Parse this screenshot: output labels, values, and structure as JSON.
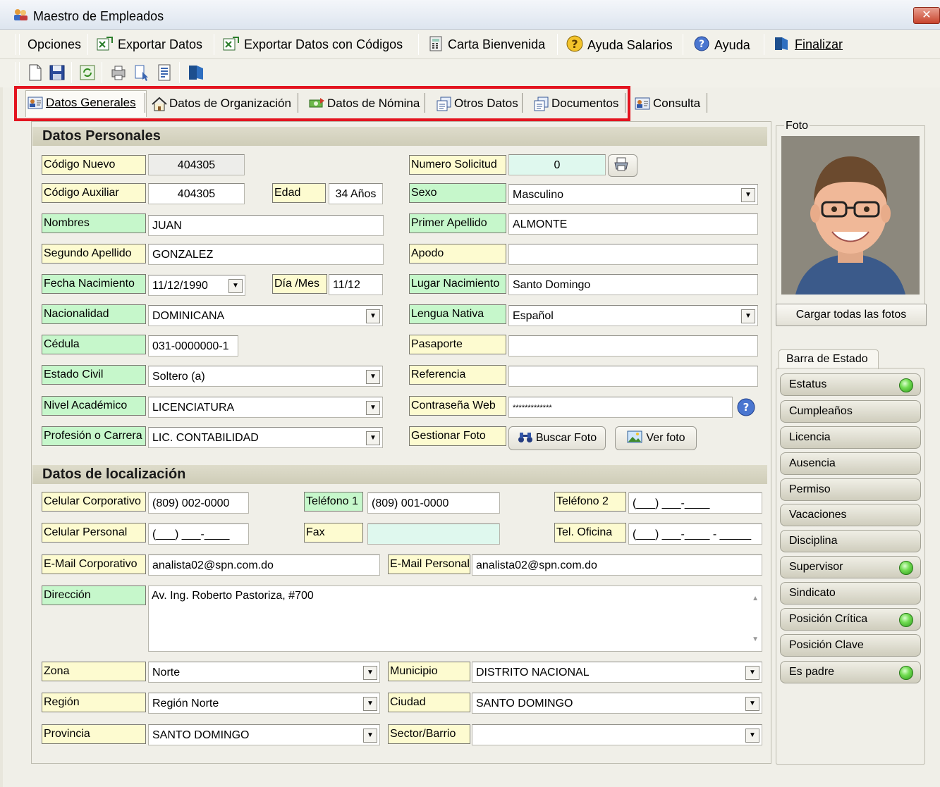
{
  "window": {
    "title": "Maestro de Empleados"
  },
  "menu": [
    {
      "label": "Opciones",
      "icon": "none"
    },
    {
      "label": "Exportar Datos",
      "icon": "excel-icon"
    },
    {
      "label": "Exportar Datos con Códigos",
      "icon": "excel-icon"
    },
    {
      "label": "Carta Bienvenida",
      "icon": "calculator-icon"
    },
    {
      "label": "Ayuda Salarios",
      "icon": "question-icon"
    },
    {
      "label": "Ayuda",
      "icon": "help-icon"
    },
    {
      "label": "Finalizar",
      "icon": "exit-icon"
    }
  ],
  "tabs": [
    {
      "label": "Datos Generales",
      "icon": "person-card-icon",
      "active": true
    },
    {
      "label": "Datos de Organización",
      "icon": "home-icon"
    },
    {
      "label": "Datos de Nómina",
      "icon": "money-icon"
    },
    {
      "label": "Otros Datos",
      "icon": "documents-icon"
    },
    {
      "label": "Documentos",
      "icon": "documents-icon"
    },
    {
      "label": "Consulta",
      "icon": "person-card-icon"
    }
  ],
  "sections": {
    "personal": "Datos Personales",
    "location": "Datos de localización"
  },
  "personal": {
    "codigo_nuevo": {
      "label": "Código Nuevo",
      "value": "404305"
    },
    "codigo_auxiliar": {
      "label": "Código Auxiliar",
      "value": "404305"
    },
    "edad": {
      "label": "Edad",
      "value": "34 Años"
    },
    "nombres": {
      "label": "Nombres",
      "value": "JUAN"
    },
    "segundo_apellido": {
      "label": "Segundo Apellido",
      "value": "GONZALEZ"
    },
    "fecha_nacimiento": {
      "label": "Fecha Nacimiento",
      "value": "11/12/1990"
    },
    "dia_mes": {
      "label": "Día /Mes",
      "value": "11/12"
    },
    "nacionalidad": {
      "label": "Nacionalidad",
      "value": "DOMINICANA"
    },
    "cedula": {
      "label": "Cédula",
      "value": "031-0000000-1"
    },
    "estado_civil": {
      "label": "Estado Civil",
      "value": "Soltero (a)"
    },
    "nivel_academico": {
      "label": "Nivel Académico",
      "value": "LICENCIATURA"
    },
    "profesion": {
      "label": "Profesión o Carrera",
      "value": "LIC. CONTABILIDAD"
    },
    "numero_solicitud": {
      "label": "Numero Solicitud",
      "value": "0"
    },
    "sexo": {
      "label": "Sexo",
      "value": "Masculino"
    },
    "primer_apellido": {
      "label": "Primer Apellido",
      "value": "ALMONTE"
    },
    "apodo": {
      "label": "Apodo",
      "value": ""
    },
    "lugar_nacimiento": {
      "label": "Lugar Nacimiento",
      "value": "Santo Domingo"
    },
    "lengua_nativa": {
      "label": "Lengua Nativa",
      "value": "Español"
    },
    "pasaporte": {
      "label": "Pasaporte",
      "value": ""
    },
    "referencia": {
      "label": "Referencia",
      "value": ""
    },
    "contrasena_web": {
      "label": "Contraseña Web",
      "value": "*************"
    },
    "gestionar_foto": {
      "label": "Gestionar Foto"
    },
    "buscar_foto": "Buscar Foto",
    "ver_foto": "Ver foto"
  },
  "location": {
    "celular_corporativo": {
      "label": "Celular Corporativo",
      "value": "(809) 002-0000"
    },
    "telefono1": {
      "label": "Teléfono 1",
      "value": "(809) 001-0000"
    },
    "telefono2": {
      "label": "Teléfono 2",
      "value": "(___) ___-____"
    },
    "celular_personal": {
      "label": "Celular Personal",
      "value": "(___) ___-____"
    },
    "fax": {
      "label": "Fax",
      "value": ""
    },
    "tel_oficina": {
      "label": "Tel. Oficina",
      "value": "(___) ___-____ - _____"
    },
    "email_corporativo": {
      "label": "E-Mail Corporativo",
      "value": "analista02@spn.com.do"
    },
    "email_personal": {
      "label": "E-Mail Personal",
      "value": "analista02@spn.com.do"
    },
    "direccion": {
      "label": "Dirección",
      "value": "Av. Ing. Roberto Pastoriza, #700"
    },
    "zona": {
      "label": "Zona",
      "value": "Norte"
    },
    "region": {
      "label": "Región",
      "value": "Región Norte"
    },
    "provincia": {
      "label": "Provincia",
      "value": "SANTO DOMINGO"
    },
    "municipio": {
      "label": "Municipio",
      "value": "DISTRITO NACIONAL"
    },
    "ciudad": {
      "label": "Ciudad",
      "value": "SANTO DOMINGO"
    },
    "sector": {
      "label": "Sector/Barrio",
      "value": ""
    }
  },
  "photo": {
    "group_label": "Foto",
    "load_all_label": "Cargar todas las fotos"
  },
  "status_bar": {
    "tab_label": "Barra de Estado",
    "items": [
      {
        "label": "Estatus",
        "led": true
      },
      {
        "label": "Cumpleaños",
        "led": false
      },
      {
        "label": "Licencia",
        "led": false
      },
      {
        "label": "Ausencia",
        "led": false
      },
      {
        "label": "Permiso",
        "led": false
      },
      {
        "label": "Vacaciones",
        "led": false
      },
      {
        "label": "Disciplina",
        "led": false
      },
      {
        "label": "Supervisor",
        "led": true
      },
      {
        "label": "Sindicato",
        "led": false
      },
      {
        "label": "Posición Crítica",
        "led": true
      },
      {
        "label": "Posición Clave",
        "led": false
      },
      {
        "label": "Es padre",
        "led": true
      }
    ]
  },
  "colors": {
    "highlight": "#e3141f",
    "label_yellow": "#fdfbd0",
    "label_green": "#c6f7cb",
    "status_led": "#4fc23a"
  }
}
